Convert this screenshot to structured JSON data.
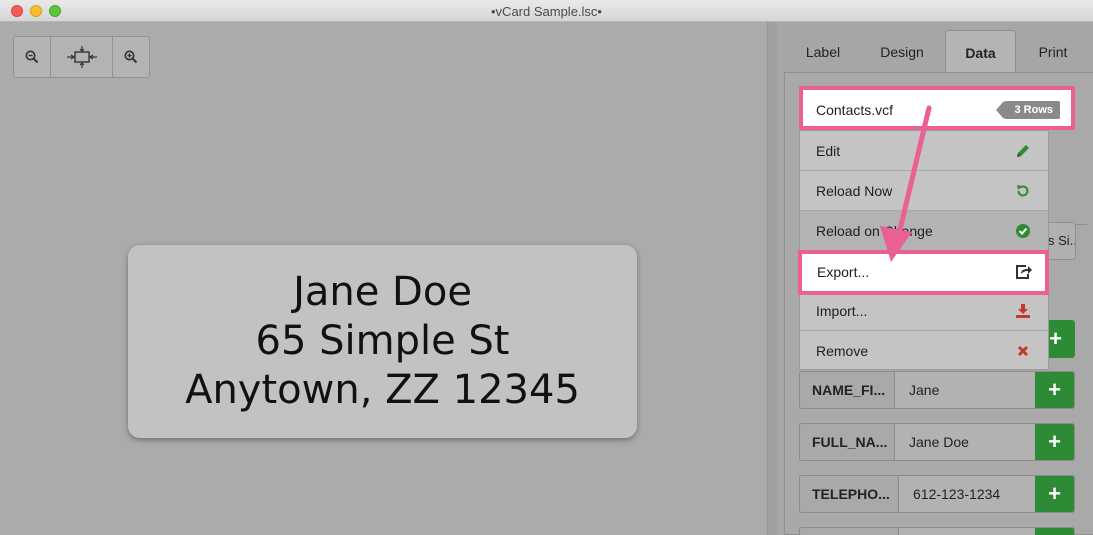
{
  "window": {
    "title": "•vCard Sample.lsc•"
  },
  "toolbar": {
    "zoom_out_icon": "zoom-out-icon",
    "fit_icon": "fit-to-window-icon",
    "zoom_in_icon": "zoom-in-icon"
  },
  "label_preview": {
    "lines": [
      "Jane Doe",
      "65 Simple St",
      "Anytown, ZZ 12345"
    ]
  },
  "tabs": [
    {
      "label": "Label",
      "active": false
    },
    {
      "label": "Design",
      "active": false
    },
    {
      "label": "Data",
      "active": true
    },
    {
      "label": "Print",
      "active": false
    }
  ],
  "data_source": {
    "file_name": "Contacts.vcf",
    "row_count_badge": "3 Rows"
  },
  "menu": [
    {
      "label": "Edit",
      "icon": "pencil-icon",
      "color": "#2f8a36"
    },
    {
      "label": "Reload Now",
      "icon": "reload-icon",
      "color": "#2f8a36"
    },
    {
      "label": "Reload on Change",
      "icon": "check-circle-icon",
      "color": "#2f8a36"
    },
    {
      "label": "Export...",
      "icon": "export-icon",
      "color": "#333333"
    },
    {
      "label": "Import...",
      "icon": "download-icon",
      "color": "#c0392b"
    },
    {
      "label": "Remove",
      "icon": "remove-icon",
      "color": "#c0392b"
    }
  ],
  "partial_input_text": "s Si...",
  "fields": [
    {
      "name": "NAME_FI...",
      "value": "Jane"
    },
    {
      "name": "FULL_NA...",
      "value": "Jane Doe"
    },
    {
      "name": "TELEPHO...",
      "value": "612-123-1234"
    }
  ],
  "colors": {
    "highlight": "#ea5f94",
    "add_button": "#2d8b35"
  }
}
